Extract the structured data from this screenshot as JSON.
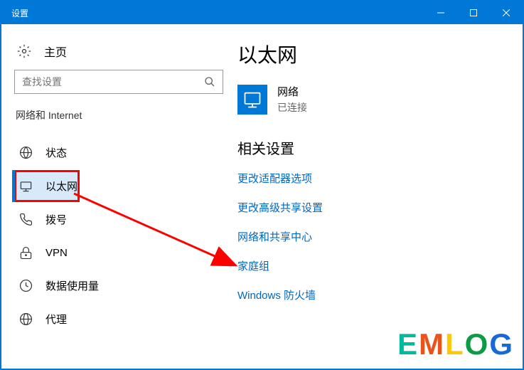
{
  "titlebar": {
    "title": "设置"
  },
  "sidebar": {
    "home_label": "主页",
    "search_placeholder": "查找设置",
    "category": "网络和 Internet",
    "items": [
      {
        "label": "状态"
      },
      {
        "label": "以太网"
      },
      {
        "label": "拨号"
      },
      {
        "label": "VPN"
      },
      {
        "label": "数据使用量"
      },
      {
        "label": "代理"
      }
    ]
  },
  "main": {
    "title": "以太网",
    "network": {
      "name": "网络",
      "status": "已连接"
    },
    "related_title": "相关设置",
    "links": [
      "更改适配器选项",
      "更改高级共享设置",
      "网络和共享中心",
      "家庭组",
      "Windows 防火墙"
    ]
  },
  "watermark": "EMLOG"
}
